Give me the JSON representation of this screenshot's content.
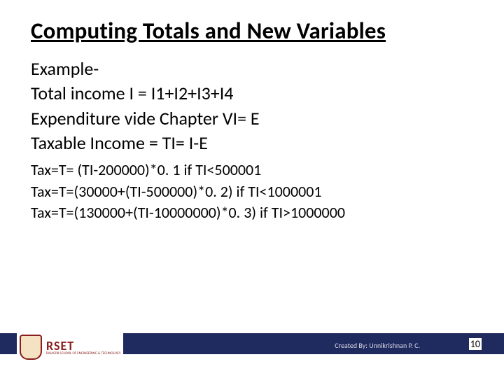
{
  "title": "Computing Totals and New Variables",
  "body": {
    "large": [
      "Example-",
      "Total income I = I1+I2+I3+I4",
      "Expenditure vide Chapter VI= E",
      "Taxable Income = TI= I-E"
    ],
    "small": [
      "Tax=T= (TI-200000)*0. 1  if TI<500001",
      "Tax=T=(30000+(TI-500000)*0. 2)  if TI<1000001",
      "Tax=T=(130000+(TI-10000000)*0. 3) if TI>1000000"
    ]
  },
  "logo": {
    "text": "RSET",
    "subtext": "RAJAGIRI SCHOOL OF ENGINEERING & TECHNOLOGY"
  },
  "footer": {
    "credit": "Created By: Unnikrishnan P. C.",
    "page": "10"
  }
}
